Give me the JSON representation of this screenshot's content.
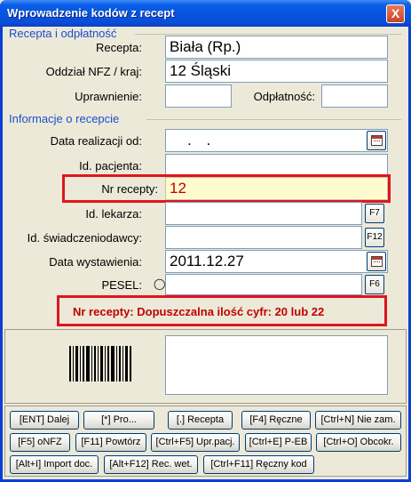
{
  "window": {
    "title": "Wprowadzenie kodów z recept",
    "close_label": "X"
  },
  "section_recepta": {
    "title": "Recepta i odpłatność",
    "recepta_label": "Recepta:",
    "recepta_value": "Biała (Rp.)",
    "oddzial_label": "Oddział NFZ / kraj:",
    "oddzial_value": "12 Śląski",
    "uprawnienie_label": "Uprawnienie:",
    "uprawnienie_value": "",
    "odplatnosc_label": "Odpłatność:",
    "odplatnosc_value": ""
  },
  "section_info": {
    "title": "Informacje o recepcie",
    "data_realizacji_label": "Data realizacji od:",
    "data_realizacji_value": ". .",
    "id_pacjenta_label": "Id. pacjenta:",
    "id_pacjenta_value": "",
    "nr_recepty_label": "Nr recepty:",
    "nr_recepty_value": "12",
    "id_lekarza_label": "Id. lekarza:",
    "id_lekarza_value": "",
    "id_swiadczeniodawcy_label": "Id. świadczeniodawcy:",
    "id_swiadczeniodawcy_value": "",
    "data_wystawienia_label": "Data wystawienia:",
    "data_wystawienia_value": "2011.12.27",
    "pesel_label": "PESEL:",
    "pesel_value": "",
    "f7_label": "F7",
    "f12_label": "F12",
    "f6_label": "F6",
    "error_message": "Nr recepty: Dopuszczalna ilość cyfr: 20 lub 22"
  },
  "buttons": {
    "row1": [
      "[ENT] Dalej",
      "[*] Pro...",
      "[.] Recepta",
      "[F4] Ręczne",
      "[Ctrl+N] Nie zam."
    ],
    "row2": [
      "[F5] oNFZ",
      "[F11] Powtórz",
      "[Ctrl+F5] Upr.pacj.",
      "[Ctrl+E] P-EB",
      "[Ctrl+O] Obcokr."
    ],
    "row3": [
      "[Alt+I] Import doc.",
      "[Alt+F12] Rec. wet.",
      "[Ctrl+F11] Ręczny kod"
    ]
  },
  "colors": {
    "title_bar": "#0754e0",
    "section_title": "#1a4fd0",
    "highlight_field": "#fffbd0",
    "error_red": "#e0141e"
  }
}
